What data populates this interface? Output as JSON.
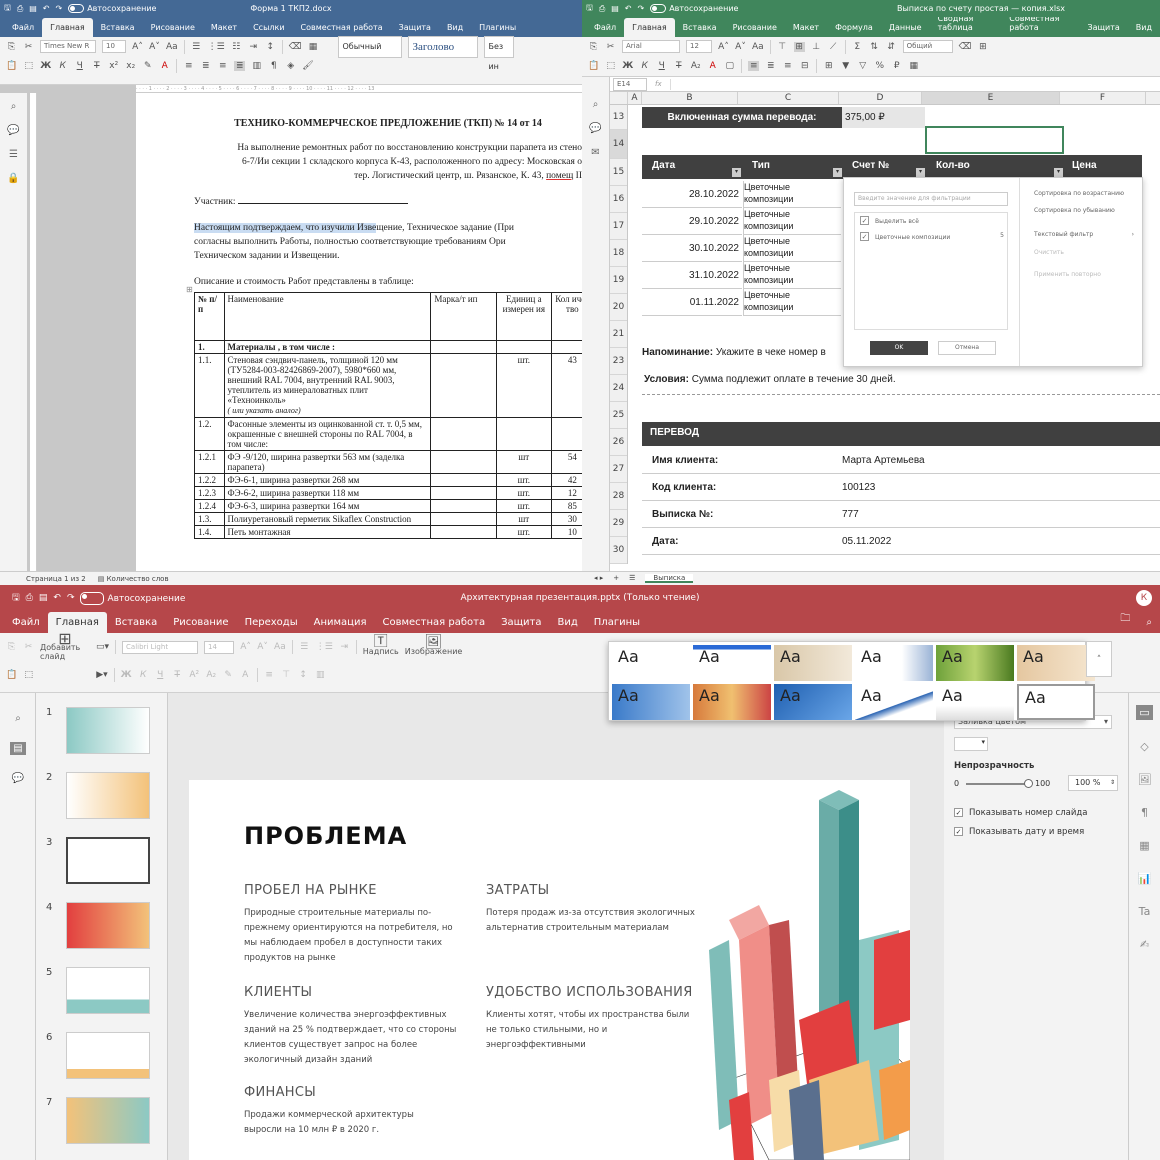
{
  "word": {
    "title": "Форма 1 ТКП2.docx",
    "autosave": "Автосохранение",
    "tabs": [
      "Файл",
      "Главная",
      "Вставка",
      "Рисование",
      "Макет",
      "Ссылки",
      "Совместная работа",
      "Защита",
      "Вид",
      "Плагины"
    ],
    "font": "Times New R",
    "size": "10",
    "styles": [
      "Обычный",
      "Заголово",
      "Без ин"
    ],
    "doc": {
      "heading": "ТЕХНИКО-КОММЕРЧЕСКОЕ ПРЕДЛОЖЕНИЕ (ТКП) № 14 от 14",
      "intro1": "На выполнение ремонтных работ по восстановлению конструкции парапета из стено",
      "intro2": "6-7/Ии секции 1 складского корпуса К-43, расположенного по адресу: Московская о",
      "intro3a": "тер. Логистический центр, ш. Рязанское, К. 43, ",
      "intro3b": "помещ",
      "intro3c": " II",
      "participant": "Участник:",
      "confirm_a": "Настоящим подтверждаем, что изучили Изве",
      "confirm_b": "щение, Техническое задание (При",
      "confirm2": "согласны выполнить Работы, полностью соответствующие требованиям Ори",
      "confirm3": "Техническом задании и Извещении.",
      "desc": "Описание и стоимость Работ представлены в таблице:",
      "table_head": [
        "№ п/п",
        "Наименование",
        "Марка/т ип",
        "Единиц а измерен ия",
        "Кол ичес тво"
      ],
      "rows": [
        {
          "n": "1.",
          "name": "Материалы , в том числе :",
          "unit": "",
          "qty": ""
        },
        {
          "n": "1.1.",
          "name": "Стеновая сэндвич-панель, толщиной 120 мм (ТУ5284-003-82426869-2007), 5980*660 мм, внешний RAL 7004, внутренний RAL 9003, утеплитель из минераловатных плит «Техноинколь»",
          "note": "( или указать аналог)",
          "unit": "шт.",
          "qty": "43"
        },
        {
          "n": "1.2.",
          "name": "Фасонные элементы из оцинкованной ст. т. 0,5 мм, окрашенные с внешней стороны по RAL 7004, в том числе:",
          "unit": "",
          "qty": ""
        },
        {
          "n": "1.2.1",
          "name": "ФЭ -9/120, ширина развертки 563 мм (заделка парапета)",
          "unit": "шт",
          "qty": "54"
        },
        {
          "n": "1.2.2",
          "name": "ФЭ-6-1, ширина развертки 268 мм",
          "unit": "шт.",
          "qty": "42"
        },
        {
          "n": "1.2.3",
          "name": "ФЭ-6-2, ширина развертки 118 мм",
          "unit": "шт.",
          "qty": "12"
        },
        {
          "n": "1.2.4",
          "name": "ФЭ-6-3, ширина развертки 164 мм",
          "unit": "шт.",
          "qty": "85"
        },
        {
          "n": "1.3.",
          "name": "Полиуретановый герметик Sikaflex Construction",
          "unit": "шт",
          "qty": "30"
        },
        {
          "n": "1.4.",
          "name": "Петь монтажная",
          "unit": "шт.",
          "qty": "10"
        }
      ]
    },
    "status": {
      "page": "Страница 1 из 2",
      "words": "Количество слов"
    }
  },
  "excel": {
    "title": "Выписка по счету простая — копия.xlsx",
    "autosave": "Автосохранение",
    "tabs": [
      "Файл",
      "Главная",
      "Вставка",
      "Рисование",
      "Макет",
      "Формула",
      "Данные",
      "Сводная таблица",
      "Совместная работа",
      "Защита",
      "Вид"
    ],
    "font": "Arial",
    "size": "12",
    "numfmt": "Общий",
    "cellref": "E14",
    "fx": "fx",
    "cols": [
      "A",
      "B",
      "C",
      "D",
      "E",
      "F"
    ],
    "rownums": [
      "13",
      "14",
      "15",
      "16",
      "17",
      "18",
      "19",
      "20",
      "21",
      "23",
      "24",
      "25",
      "26",
      "27",
      "28",
      "29",
      "30"
    ],
    "sum_label": "Включенная сумма перевода:",
    "sum_value": "375,00 ₽",
    "headers": [
      "Дата",
      "Тип",
      "Счет №",
      "Кол-во",
      "Цена"
    ],
    "entries": [
      {
        "date": "28.10.2022",
        "type": "Цветочные композиции"
      },
      {
        "date": "29.10.2022",
        "type": "Цветочные композиции"
      },
      {
        "date": "30.10.2022",
        "type": "Цветочные композиции"
      },
      {
        "date": "31.10.2022",
        "type": "Цветочные композиции"
      },
      {
        "date": "01.11.2022",
        "type": "Цветочные композиции"
      }
    ],
    "reminder_label": "Напоминание:",
    "reminder": "Укажите в чеке номер в",
    "terms_label": "Условия:",
    "terms": "Сумма подлежит оплате в течение 30 дней.",
    "transfer_title": "ПЕРЕВОД",
    "transfer": [
      {
        "k": "Имя клиента:",
        "v": "Марта Артемьева"
      },
      {
        "k": "Код клиента:",
        "v": "100123"
      },
      {
        "k": "Выписка №:",
        "v": "777"
      },
      {
        "k": "Дата:",
        "v": "05.11.2022"
      }
    ],
    "filter": {
      "placeholder": "Введите значение для фильтрации",
      "select_all": "Выделить всё",
      "item": "Цветочные композиции",
      "item_count": "5",
      "sort_asc": "Сортировка по возрастанию",
      "sort_desc": "Сортировка по убыванию",
      "text_filter": "Текстовый фильтр",
      "clear": "Очистить",
      "reapply": "Применить повторно",
      "ok": "OK",
      "cancel": "Отмена"
    },
    "sheet": "Выписка"
  },
  "ppt": {
    "title": "Архитектурная презентация.pptx (Только чтение)",
    "autosave": "Автосохранение",
    "user": "К",
    "tabs": [
      "Файл",
      "Главная",
      "Вставка",
      "Рисование",
      "Переходы",
      "Анимация",
      "Совместная работа",
      "Защита",
      "Вид",
      "Плагины"
    ],
    "add_slide": "Добавить слайд",
    "font": "Calibri Light",
    "size": "14",
    "textbox": "Надпись",
    "image": "Изображение",
    "theme_label": "Aa",
    "slide": {
      "title": "ПРОБЛЕМА",
      "blocks": [
        {
          "h": "ПРОБЕЛ НА РЫНКЕ",
          "p": "Природные строительные материалы по-прежнему ориентируются на потребителя, но мы наблюдаем пробел в доступности таких продуктов на рынке"
        },
        {
          "h": "ЗАТРАТЫ",
          "p": "Потеря продаж из-за отсутствия экологичных альтернатив строительным материалам"
        },
        {
          "h": "КЛИЕНТЫ",
          "p": "Увеличение количества энергоэффективных зданий на 25 % подтверждает, что со стороны клиентов существует запрос на более экологичный дизайн зданий"
        },
        {
          "h": "УДОБСТВО ИСПОЛЬЗОВАНИЯ",
          "p": "Клиенты хотят, чтобы их пространства были не только стильными, но и энергоэффективными"
        },
        {
          "h": "ФИНАНСЫ",
          "p": "Продажи коммерческой архитектуры выросли на 10 млн ₽ в 2020 г."
        }
      ]
    },
    "thumbs": [
      "1",
      "2",
      "3",
      "4",
      "5",
      "6",
      "7"
    ],
    "right": {
      "fill_label": "Заливка цветом",
      "opacity": "Непрозрачность",
      "opacity_min": "0",
      "opacity_max": "100",
      "opacity_val": "100 %",
      "opacity_pct": 100,
      "chk1": "Показывать номер слайда",
      "chk2": "Показывать дату и время"
    }
  },
  "colors": {
    "word": "#446995",
    "excel": "#40865c",
    "ppt": "#b6474a"
  }
}
